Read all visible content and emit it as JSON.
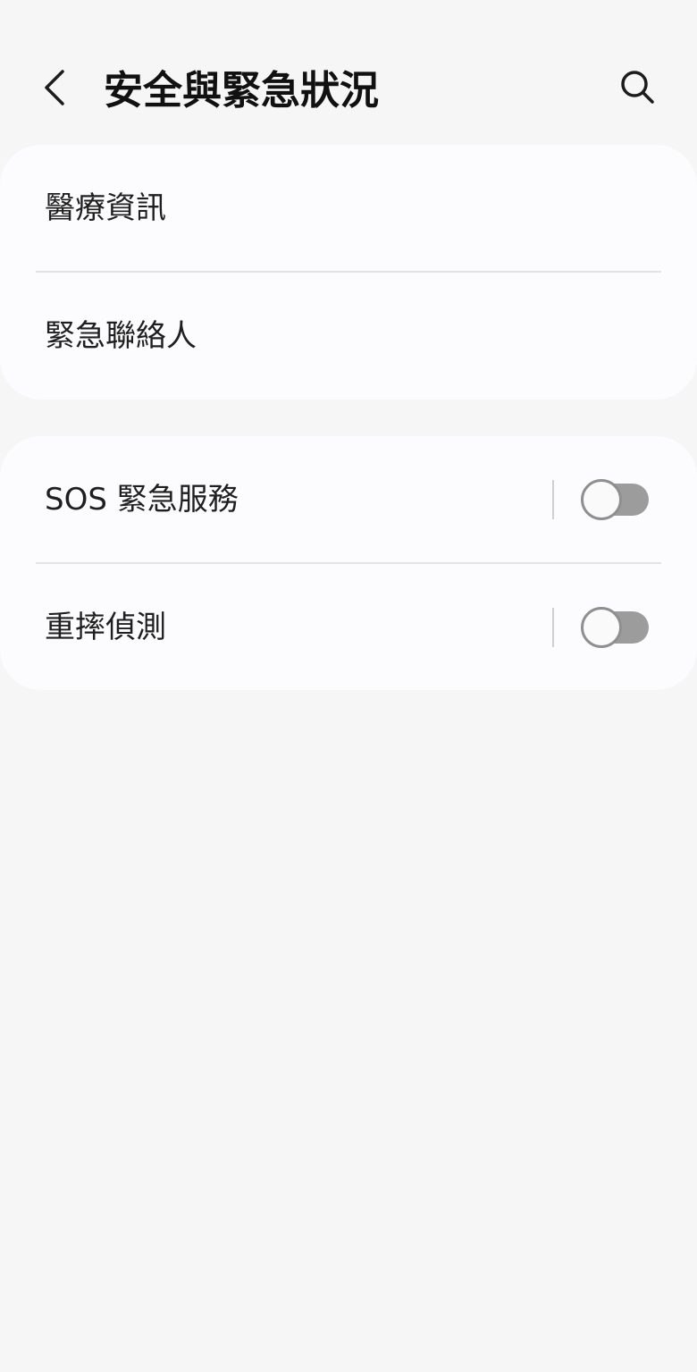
{
  "header": {
    "title": "安全與緊急狀況",
    "back_icon": "chevron-left-icon",
    "search_icon": "search-icon"
  },
  "group_info": {
    "items": [
      {
        "label": "醫療資訊"
      },
      {
        "label": "緊急聯絡人"
      }
    ]
  },
  "group_features": {
    "items": [
      {
        "label": "SOS 緊急服務",
        "toggle_on": false
      },
      {
        "label": "重摔偵測",
        "toggle_on": false
      }
    ]
  },
  "colors": {
    "background": "#f6f6f6",
    "card": "#fcfcfe",
    "toggle_off_track": "#9c9c9c"
  }
}
